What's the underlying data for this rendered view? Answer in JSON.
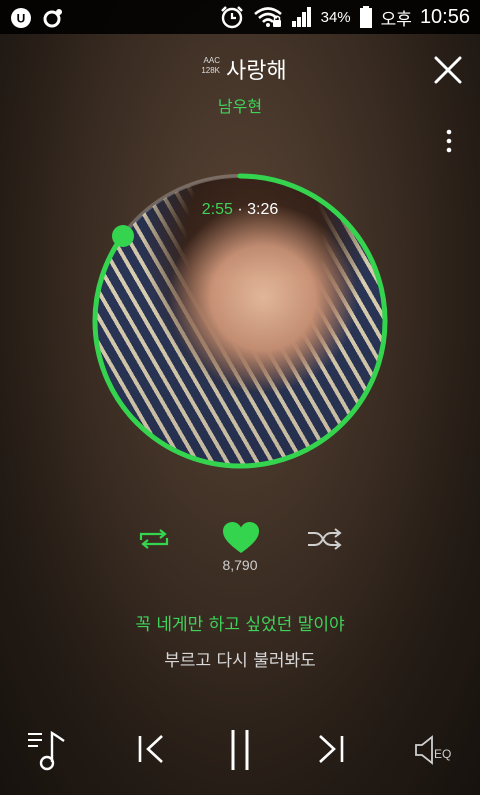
{
  "status_bar": {
    "battery_percent": "34%",
    "am_pm": "오후",
    "time": "10:56"
  },
  "track": {
    "quality_codec": "AAC",
    "quality_bitrate": "128K",
    "title": "사랑해",
    "artist": "남우현",
    "elapsed": "2:55",
    "separator": "·",
    "duration": "3:26",
    "progress_fraction": 0.85
  },
  "likes": {
    "count": "8,790"
  },
  "lyrics": {
    "current": "꼭 네게만 하고 싶었던 말이야",
    "next": "부르고 다시 불러봐도"
  },
  "eq_label": "EQ",
  "colors": {
    "accent": "#35d44f"
  },
  "icons": {
    "close": "close-icon",
    "more": "more-vertical-icon",
    "repeat": "repeat-icon",
    "like": "heart-icon",
    "shuffle": "shuffle-icon",
    "playlist": "playlist-icon",
    "prev": "previous-icon",
    "pause": "pause-icon",
    "next": "next-icon",
    "eq": "equalizer-icon"
  }
}
